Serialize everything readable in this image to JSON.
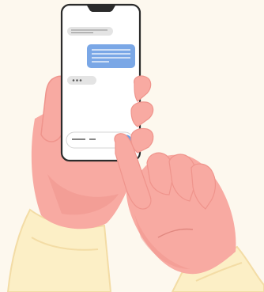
{
  "illustration": {
    "subject": "hands-holding-smartphone-messaging",
    "colors": {
      "background": "#fdf8ee",
      "skin": "#f8aaa2",
      "skin_shadow": "#ef948c",
      "skin_line": "#e0877f",
      "sleeve": "#fcefc6",
      "sleeve_shadow": "#f3dca5",
      "phone_body": "#ffffff",
      "phone_outline": "#2b2b2b",
      "incoming_bubble": "#e4e4e4",
      "outgoing_bubble": "#7aa7e6",
      "send_button": "#6f9fe3",
      "input_line": "#3a3a3a"
    },
    "phone": {
      "messages": [
        {
          "type": "incoming",
          "kind": "text-lines",
          "lines": 2
        },
        {
          "type": "outgoing",
          "kind": "text-lines",
          "lines": 4
        },
        {
          "type": "incoming",
          "kind": "typing-indicator"
        }
      ],
      "composer": {
        "kind": "text-input-with-send",
        "send_icon": "arrow-up-icon"
      }
    }
  }
}
